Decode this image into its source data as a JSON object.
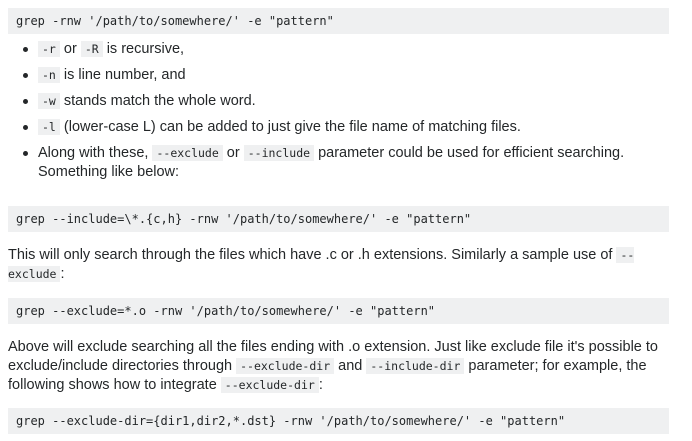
{
  "blocks": {
    "cmd1": "grep -rnw '/path/to/somewhere/' -e \"pattern\"",
    "cmd2": "grep --include=\\*.{c,h} -rnw '/path/to/somewhere/' -e \"pattern\"",
    "cmd3": "grep --exclude=*.o -rnw '/path/to/somewhere/' -e \"pattern\"",
    "cmd4": "grep --exclude-dir={dir1,dir2,*.dst} -rnw '/path/to/somewhere/' -e \"pattern\""
  },
  "bullets": [
    {
      "code_a": "-r",
      "mid": " or ",
      "code_b": "-R",
      "text": " is recursive,"
    },
    {
      "code_a": "-n",
      "text": " is line number, and"
    },
    {
      "code_a": "-w",
      "text": " stands match the whole word."
    },
    {
      "code_a": "-l",
      "text": " (lower-case L) can be added to just give the file name of matching files."
    },
    {
      "pre": "Along with these, ",
      "code_a": "--exclude",
      "mid": " or ",
      "code_b": "--include",
      "text": " parameter could be used for efficient searching. Something like below:"
    }
  ],
  "para1": {
    "text": "This will only search through the files which have .c or .h extensions. Similarly a sample use of ",
    "code": "--exclude",
    "end": ":"
  },
  "para2": {
    "text": "Above will exclude searching all the files ending with .o extension. Just like exclude file it's possible to exclude/include directories through ",
    "code_a": "--exclude-dir",
    "mid": " and ",
    "code_b": "--include-dir",
    "text2": " parameter; for example, the following shows how to integrate ",
    "code_c": "--exclude-dir",
    "end": ":"
  }
}
